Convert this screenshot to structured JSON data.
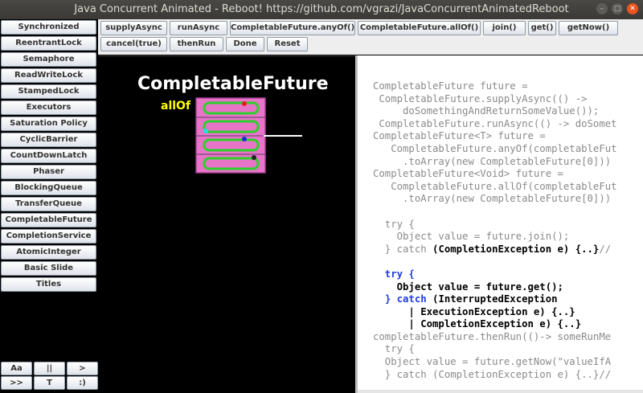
{
  "window": {
    "title": "Java Concurrent Animated - Reboot! https://github.com/vgrazi/JavaConcurrentAnimatedReboot",
    "min_glyph": "–",
    "max_glyph": "□",
    "close_glyph": "✕"
  },
  "sidebar": {
    "items": [
      "Synchronized",
      "ReentrantLock",
      "Semaphore",
      "ReadWriteLock",
      "StampedLock",
      "Executors",
      "Saturation Policy",
      "CyclicBarrier",
      "CountDownLatch",
      "Phaser",
      "BlockingQueue",
      "TransferQueue",
      "CompletableFuture",
      "CompletionService",
      "AtomicInteger",
      "Basic Slide",
      "Titles"
    ],
    "controls": [
      "Aa",
      "||",
      ">",
      ">>",
      "T",
      ":)"
    ]
  },
  "toolbar": {
    "buttons": [
      "supplyAsync",
      "runAsync",
      "CompletableFuture.anyOf()",
      "CompletableFuture.allOf()",
      "join()",
      "get()",
      "getNow()",
      "cancel(true)",
      "thenRun",
      "Done",
      "Reset"
    ]
  },
  "animation": {
    "title": "CompletableFuture",
    "subtitle": "allOf",
    "thread_colors": [
      "#e02020",
      "#20e0e0",
      "#1a2ad8",
      "#222222"
    ],
    "accent_pink": "#e874c8",
    "accent_green": "#2bd12b"
  },
  "code": {
    "lines": [
      "CompletableFuture future =",
      " CompletableFuture.supplyAsync(() ->",
      "     doSomethingAndReturnSomeValue());",
      " CompletableFuture.runAsync(() -> doSomet",
      "CompletableFuture<T> future =",
      "   CompletableFuture.anyOf(completableFut",
      "     .toArray(new CompletableFuture[0]))",
      "CompletableFuture<Void> future =",
      "   CompletableFuture.allOf(completableFut",
      "     .toArray(new CompletableFuture[0]))",
      "",
      "  try {",
      "    Object value = future.join();",
      "  } catch (CompletionException e) {..}//",
      "",
      "  try {",
      "    Object value = future.get();",
      "  } catch (InterruptedException",
      "      | ExecutionException e) {..}",
      "      | CompletionException e) {..}",
      "completableFuture.thenRun(()-> someRunMe",
      "  try {",
      "  Object value = future.getNow(\"valueIfA",
      "  } catch (CompletionException e) {..}//"
    ]
  }
}
